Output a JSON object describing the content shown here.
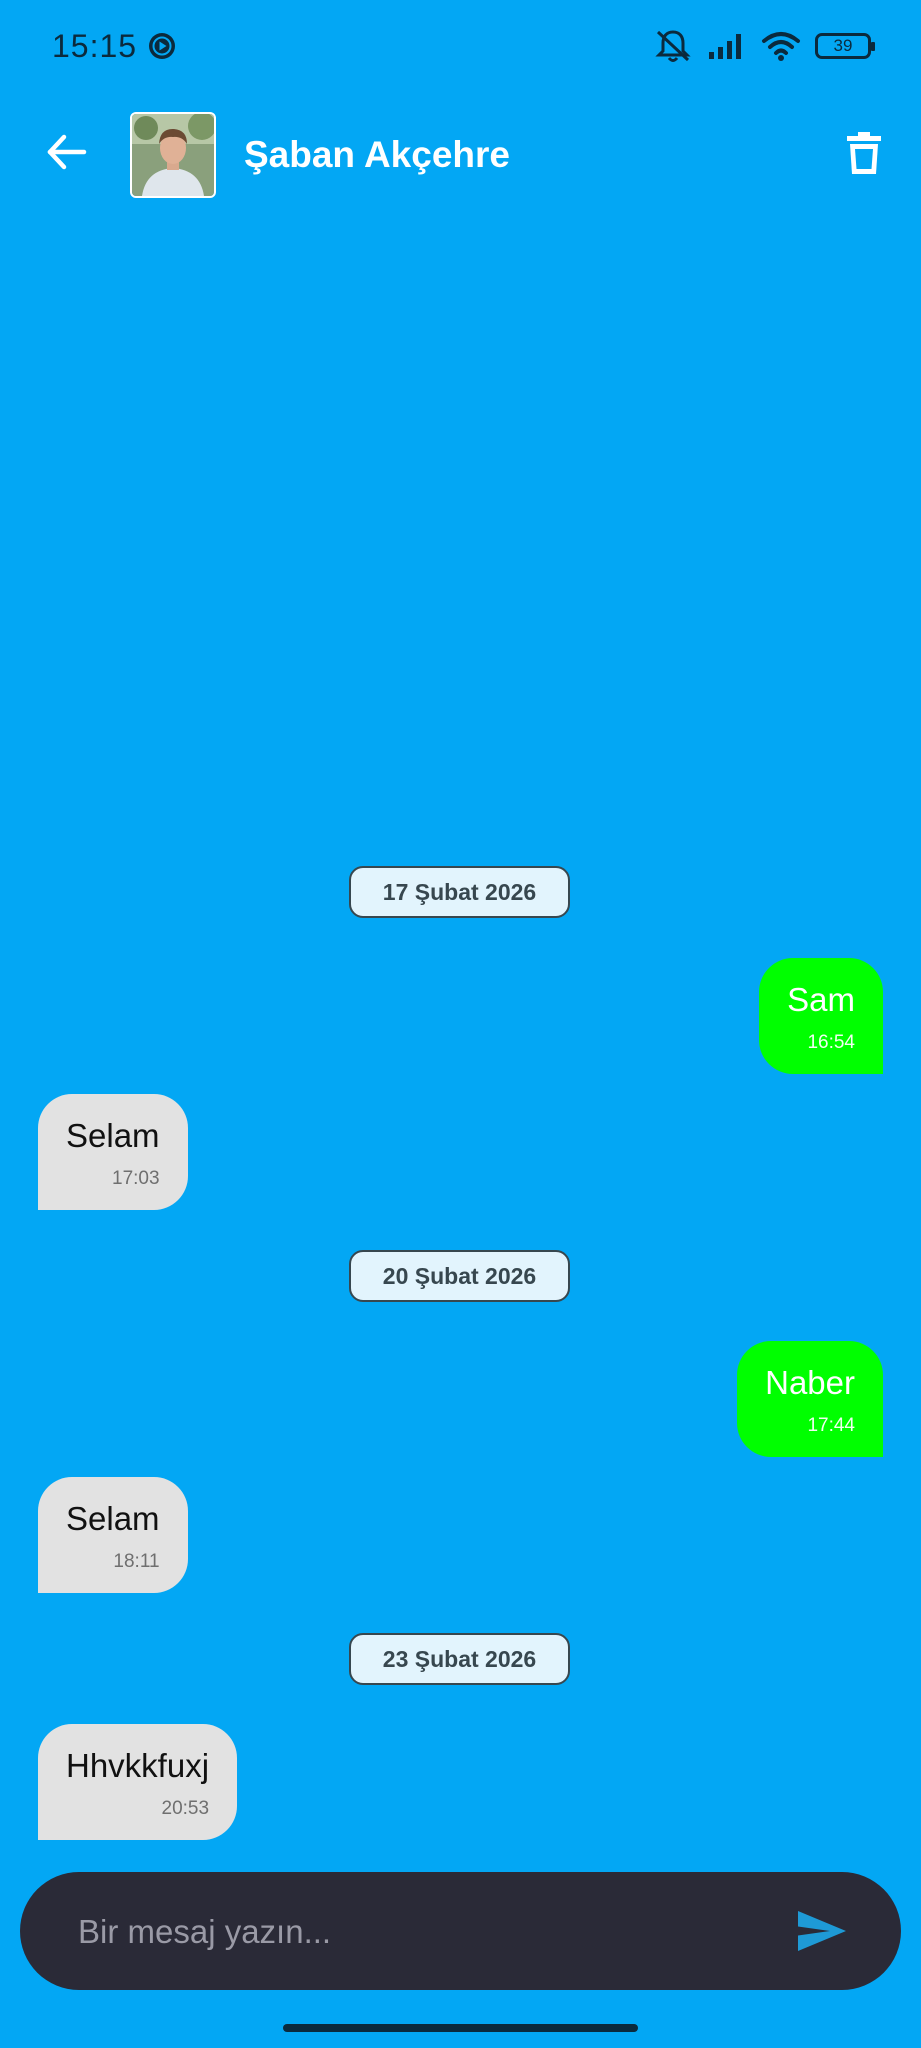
{
  "status_bar": {
    "time": "15:15",
    "battery": "39",
    "icons": [
      "media-playing-icon",
      "mute-icon",
      "signal-icon",
      "wifi-icon",
      "battery-icon"
    ]
  },
  "header": {
    "contact_name": "Şaban Akçehre",
    "icons": [
      "back-arrow-icon",
      "trash-icon"
    ]
  },
  "chat": {
    "dates": [
      "17 Şubat 2026",
      "20 Şubat 2026",
      "23 Şubat 2026"
    ],
    "messages": [
      {
        "text": "Sam",
        "time": "16:54",
        "direction": "sent"
      },
      {
        "text": "Selam",
        "time": "17:03",
        "direction": "received"
      },
      {
        "text": "Naber",
        "time": "17:44",
        "direction": "sent"
      },
      {
        "text": "Selam",
        "time": "18:11",
        "direction": "received"
      },
      {
        "text": "Hhvkkfuxj",
        "time": "20:53",
        "direction": "received"
      }
    ]
  },
  "input": {
    "placeholder": "Bir mesaj yazın...",
    "value": "",
    "send_icon": "send-icon"
  },
  "colors": {
    "background": "#03a7f4",
    "sent_bubble": "#00ff00",
    "received_bubble": "#e2e2e2",
    "input_bar": "#2a2a37",
    "send_icon": "#1e9ad6"
  }
}
